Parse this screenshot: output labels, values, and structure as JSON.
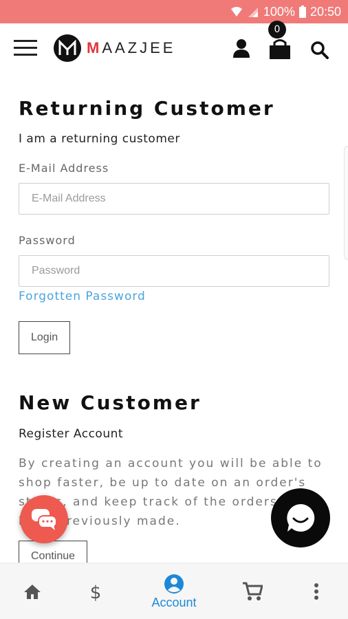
{
  "status_bar": {
    "battery": "100%",
    "time": "20:50"
  },
  "header": {
    "logo_letter": "M",
    "logo_text_accent": "M",
    "logo_text_rest": "AAZJEE",
    "cart_count": "0"
  },
  "returning": {
    "title": "Returning Customer",
    "subtitle": "I am a returning customer",
    "email_label": "E-Mail Address",
    "email_placeholder": "E-Mail Address",
    "password_label": "Password",
    "password_placeholder": "Password",
    "forgot_link": "Forgotten Password",
    "login_button": "Login"
  },
  "new_customer": {
    "title": "New Customer",
    "subtitle": "Register Account",
    "description_lines": [
      "By creating an account you will be able to",
      "shop faster, be up to date on an order's",
      "status, and keep track of the orders you",
      "have previously made."
    ],
    "continue_button": "Continue"
  },
  "bottom_nav": {
    "account_label": "Account",
    "active_color": "#1e88d8"
  },
  "colors": {
    "status_bar": "#f07a78",
    "link": "#4aa3df",
    "chat_fab": "#ee5a4f",
    "logo_accent": "#e2343b"
  }
}
